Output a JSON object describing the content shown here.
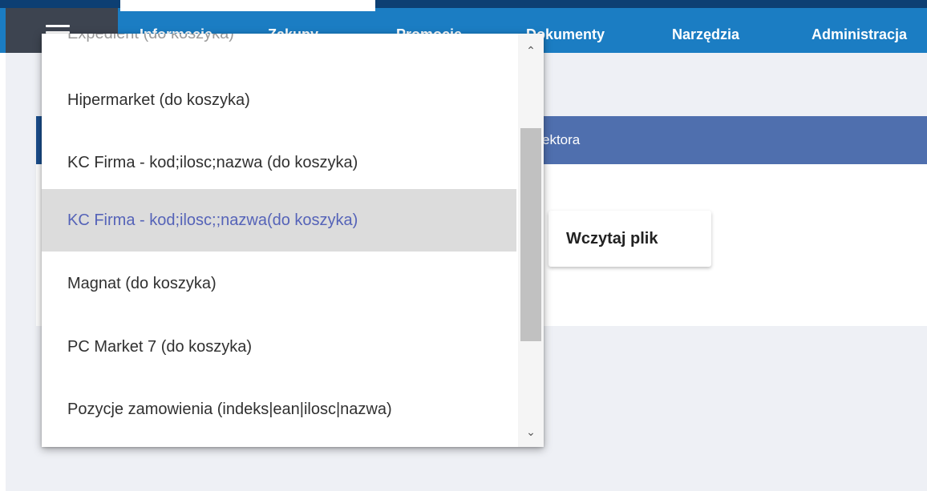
{
  "nav": {
    "items": [
      "Informacje",
      "Zakupy",
      "Promocje",
      "Dokumenty",
      "Narzędzia",
      "Administracja"
    ]
  },
  "card": {
    "title_partial": "ektora",
    "load_button": "Wczytaj plik"
  },
  "dropdown": {
    "partial_top_item": "Expedient (do koszyka)",
    "items": [
      {
        "label": "Hipermarket (do koszyka)",
        "selected": false
      },
      {
        "label": "KC Firma - kod;ilosc;nazwa (do koszyka)",
        "selected": false
      },
      {
        "label": "KC Firma - kod;ilosc;;nazwa(do koszyka)",
        "selected": true
      },
      {
        "label": "Magnat (do koszyka)",
        "selected": false
      },
      {
        "label": "PC Market 7 (do koszyka)",
        "selected": false
      },
      {
        "label": "Pozycje zamowienia (indeks|ean|ilosc|nazwa)",
        "selected": false
      }
    ],
    "scroll_up_icon": "chevron-up-icon",
    "scroll_down_icon": "chevron-down-icon"
  },
  "colors": {
    "nav_bar": "#1b7dc3",
    "nav_strip": "#0d3f73",
    "menu_button": "#3d4450",
    "card_header": "#4f6fae",
    "selected_item_text": "#5563b8",
    "selected_item_bg": "#dcdcdc",
    "page_bg": "#eef0f5"
  }
}
